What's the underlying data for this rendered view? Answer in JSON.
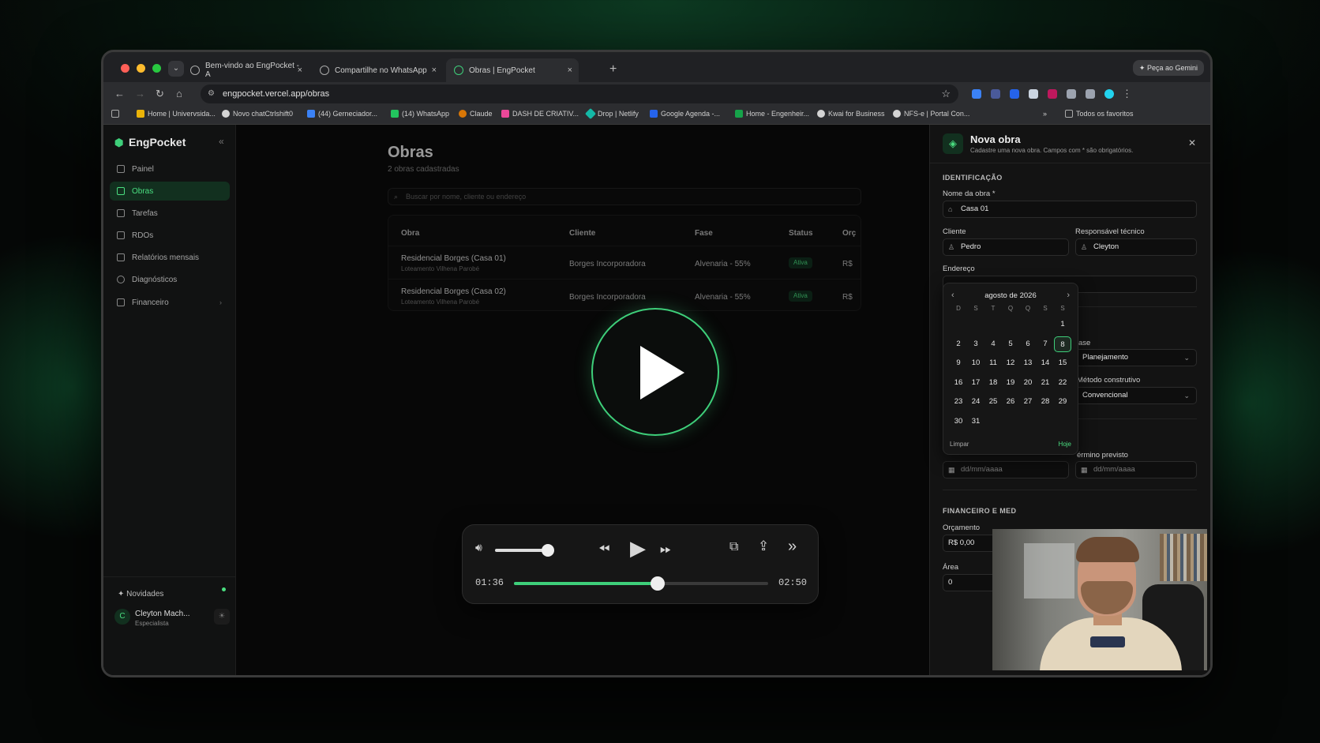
{
  "browser": {
    "tabs": [
      {
        "label": "Bem-vindo ao EngPocket - A"
      },
      {
        "label": "Compartilhe no WhatsApp"
      },
      {
        "label": "Obras | EngPocket"
      }
    ],
    "gemini_label": "Peça ao Gemini",
    "url": "engpocket.vercel.app/obras",
    "bookmarks": [
      "Home | Univervsida...",
      "Novo chatCtrlshift0",
      "(44) Gerneciador...",
      "(14) WhatsApp",
      "Claude",
      "DASH DE CRIATIV...",
      "Drop | Netlify",
      "Google Agenda -...",
      "Home - Engenheir...",
      "Kwai for Business",
      "NFS-e | Portal Con..."
    ],
    "bookmarks_all": "Todos os favoritos"
  },
  "sidebar": {
    "brand": "EngPocket",
    "items": [
      {
        "label": "Painel"
      },
      {
        "label": "Obras"
      },
      {
        "label": "Tarefas"
      },
      {
        "label": "RDOs"
      },
      {
        "label": "Relatórios mensais"
      },
      {
        "label": "Diagnósticos"
      },
      {
        "label": "Financeiro"
      }
    ],
    "news_label": "Novidades",
    "user": {
      "initial": "C",
      "name": "Cleyton Mach...",
      "role": "Especialista"
    }
  },
  "main": {
    "title": "Obras",
    "subtitle": "2 obras cadastradas",
    "search_placeholder": "Buscar por nome, cliente ou endereço",
    "columns": [
      "Obra",
      "Cliente",
      "Fase",
      "Status",
      "Orç"
    ],
    "rows": [
      {
        "obra": "Residencial Borges (Casa 01)",
        "local": "Loteamento Vilhena Parobé",
        "cliente": "Borges Incorporadora",
        "fase": "Alvenaria - 55%",
        "status": "Ativa",
        "orc": "R$"
      },
      {
        "obra": "Residencial Borges (Casa 02)",
        "local": "Loteamento Vilhena Parobé",
        "cliente": "Borges Incorporadora",
        "fase": "Alvenaria - 55%",
        "status": "Ativa",
        "orc": "R$"
      }
    ]
  },
  "panel": {
    "title": "Nova obra",
    "subtitle": "Cadastre uma nova obra. Campos com * são obrigatórios.",
    "section_id": "IDENTIFICAÇÃO",
    "nome_label": "Nome da obra *",
    "nome_value": "Casa 01",
    "cliente_label": "Cliente",
    "cliente_value": "Pedro",
    "resp_label": "Responsável técnico",
    "resp_value": "Cleyton",
    "endereco_label": "Endereço",
    "fase_label": "ase",
    "fase_value": "Planejamento",
    "metodo_label": "Método construtivo",
    "metodo_value": "Convencional",
    "termino_label": "érmino previsto",
    "date_placeholder": "dd/mm/aaaa",
    "section_fin": "FINANCEIRO E MED",
    "orcamento_label": "Orçamento",
    "orcamento_value": "R$ 0,00",
    "area_label": "Área",
    "area_value": "0"
  },
  "calendar": {
    "month": "agosto de 2026",
    "weekdays": [
      "D",
      "S",
      "T",
      "Q",
      "Q",
      "S",
      "S"
    ],
    "days": [
      "1",
      "2",
      "3",
      "4",
      "5",
      "6",
      "7",
      "8",
      "9",
      "10",
      "11",
      "12",
      "13",
      "14",
      "15",
      "16",
      "17",
      "18",
      "19",
      "20",
      "21",
      "22",
      "23",
      "24",
      "25",
      "26",
      "27",
      "28",
      "29",
      "30",
      "31"
    ],
    "selected": "8",
    "clear_label": "Limpar",
    "today_label": "Hoje"
  },
  "player": {
    "elapsed": "01:36",
    "total": "02:50",
    "progress": 0.565,
    "volume": 0.95
  },
  "colors": {
    "accent": "#3ecf7a",
    "background": "#0b0b0b"
  }
}
